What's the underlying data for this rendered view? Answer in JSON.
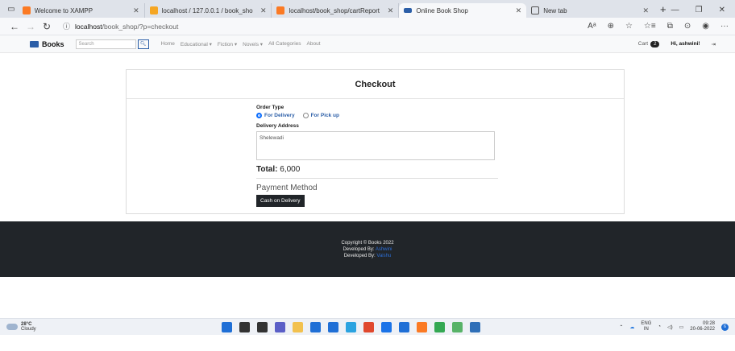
{
  "browser": {
    "tabs": [
      {
        "label": "Welcome to XAMPP",
        "icon": "xampp-icon",
        "color": "#fb7a24",
        "active": false
      },
      {
        "label": "localhost / 127.0.0.1 / book_sho",
        "icon": "phpmyadmin-icon",
        "color": "#f5a623",
        "active": false
      },
      {
        "label": "localhost/book_shop/cartReport",
        "icon": "xampp-icon",
        "color": "#fb7a24",
        "active": false
      },
      {
        "label": "Online Book Shop",
        "icon": "book-icon",
        "color": "#2b5ea7",
        "active": true
      },
      {
        "label": "New tab",
        "icon": "newtab-icon",
        "color": "#555555",
        "active": false
      }
    ],
    "new_tab_symbol": "+",
    "address": {
      "host": "localhost",
      "path": "/book_shop/?p=checkout"
    }
  },
  "site": {
    "brand": "Books",
    "search_placeholder": "Search",
    "nav_links": [
      "Home",
      "Educational ▾",
      "Fiction ▾",
      "Novels ▾",
      "All Categories",
      "About"
    ],
    "cart_label": "Cart",
    "cart_count": "2",
    "user_greeting": "Hi, ashwini!"
  },
  "checkout": {
    "title": "Checkout",
    "order_type_label": "Order Type",
    "option_delivery": "For Delivery",
    "option_pickup": "For Pick up",
    "selected_option": "delivery",
    "address_label": "Delivery Address",
    "address_value": "Shelewadi",
    "total_label": "Total:",
    "total_value": "6,000",
    "payment_title": "Payment Method",
    "payment_button": "Cash on Delivery"
  },
  "footer": {
    "copyright": "Copyright © Books 2022",
    "dev1_label": "Developed By:",
    "dev1_name": "Ashwini",
    "dev2_label": "Developed By:",
    "dev2_name": "Vaishu"
  },
  "taskbar": {
    "temperature": "28°C",
    "weather": "Cloudy",
    "lang_top": "ENG",
    "lang_bottom": "IN",
    "time": "09:28",
    "date": "20-06-2022",
    "notif_count": "6",
    "apps": [
      {
        "name": "start-icon",
        "color": "#1f6fd6"
      },
      {
        "name": "search-icon",
        "color": "#333333"
      },
      {
        "name": "taskview-icon",
        "color": "#333333"
      },
      {
        "name": "chat-icon",
        "color": "#5b5fc7"
      },
      {
        "name": "folder-icon",
        "color": "#f2c14e"
      },
      {
        "name": "store-icon",
        "color": "#1f6fd6"
      },
      {
        "name": "mail-icon",
        "color": "#1f6fd6"
      },
      {
        "name": "edge-icon",
        "color": "#2ba3e0"
      },
      {
        "name": "brave-icon",
        "color": "#e0482d"
      },
      {
        "name": "chrome-icon",
        "color": "#1a73e8"
      },
      {
        "name": "vscode-icon",
        "color": "#1f6fd6"
      },
      {
        "name": "xampp-icon",
        "color": "#fb7a24"
      },
      {
        "name": "chrome-icon-2",
        "color": "#34a853"
      },
      {
        "name": "notepad-icon",
        "color": "#58b368"
      },
      {
        "name": "photos-icon",
        "color": "#2f6fb8"
      }
    ]
  }
}
